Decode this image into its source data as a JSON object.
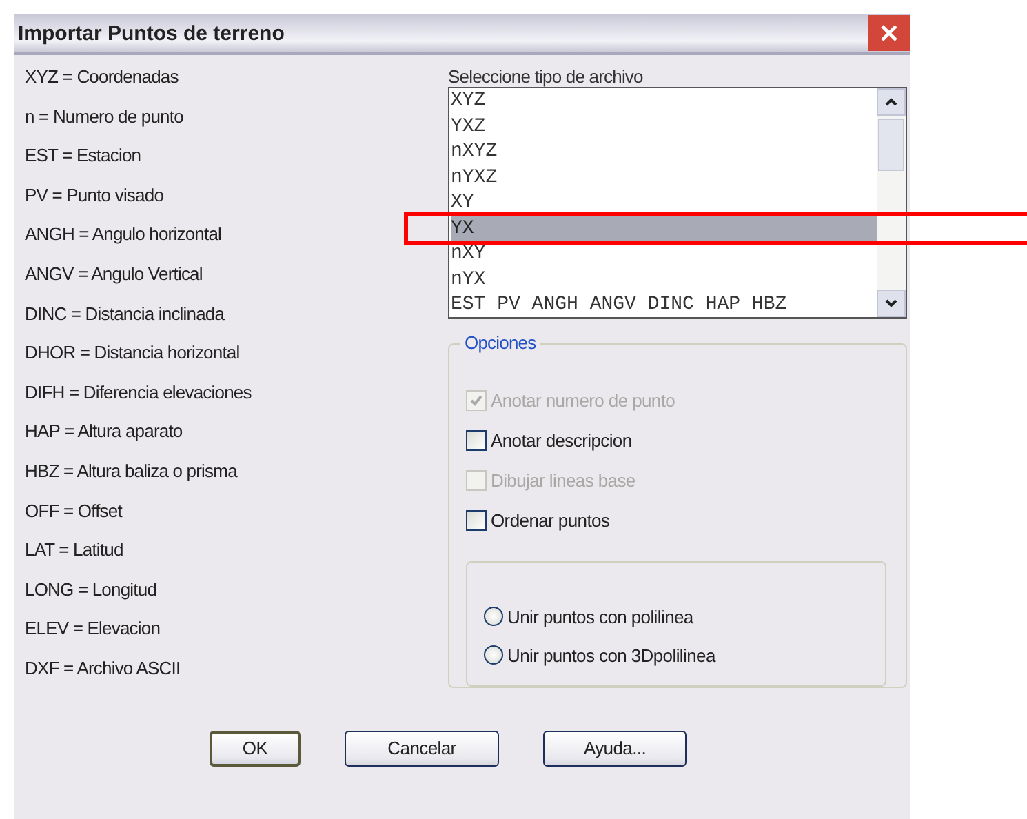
{
  "window": {
    "title": "Importar Puntos de terreno"
  },
  "legend": [
    "XYZ = Coordenadas",
    "n = Numero de punto",
    "EST = Estacion",
    "PV = Punto visado",
    "ANGH = Angulo horizontal",
    "ANGV = Angulo Vertical",
    "DINC = Distancia inclinada",
    "DHOR = Distancia horizontal",
    "DIFH = Diferencia elevaciones",
    "HAP = Altura aparato",
    "HBZ = Altura baliza o prisma",
    "OFF = Offset",
    "LAT = Latitud",
    "LONG = Longitud",
    "ELEV = Elevacion",
    "DXF = Archivo ASCII"
  ],
  "file_type": {
    "label": "Seleccione tipo de archivo",
    "items": [
      {
        "text": "XYZ",
        "selected": false
      },
      {
        "text": "YXZ",
        "selected": false
      },
      {
        "text": "nXYZ",
        "selected": false
      },
      {
        "text": "nYXZ",
        "selected": false
      },
      {
        "text": "XY",
        "selected": false
      },
      {
        "text": "YX",
        "selected": true
      },
      {
        "text": "nXY",
        "selected": false
      },
      {
        "text": "nYX",
        "selected": false
      },
      {
        "text": "EST PV ANGH ANGV DINC HAP HBZ",
        "selected": false
      }
    ]
  },
  "options": {
    "title": "Opciones",
    "checkboxes": [
      {
        "label": "Anotar numero de punto",
        "checked": true,
        "disabled": true
      },
      {
        "label": "Anotar descripcion",
        "checked": false,
        "disabled": false
      },
      {
        "label": "Dibujar lineas base",
        "checked": false,
        "disabled": true
      },
      {
        "label": "Ordenar puntos",
        "checked": false,
        "disabled": false
      }
    ],
    "radios": [
      {
        "label": "Unir puntos con polilinea",
        "selected": false
      },
      {
        "label": "Unir puntos con 3Dpolilinea",
        "selected": false
      }
    ]
  },
  "buttons": [
    "OK",
    "Cancelar",
    "Ayuda..."
  ]
}
